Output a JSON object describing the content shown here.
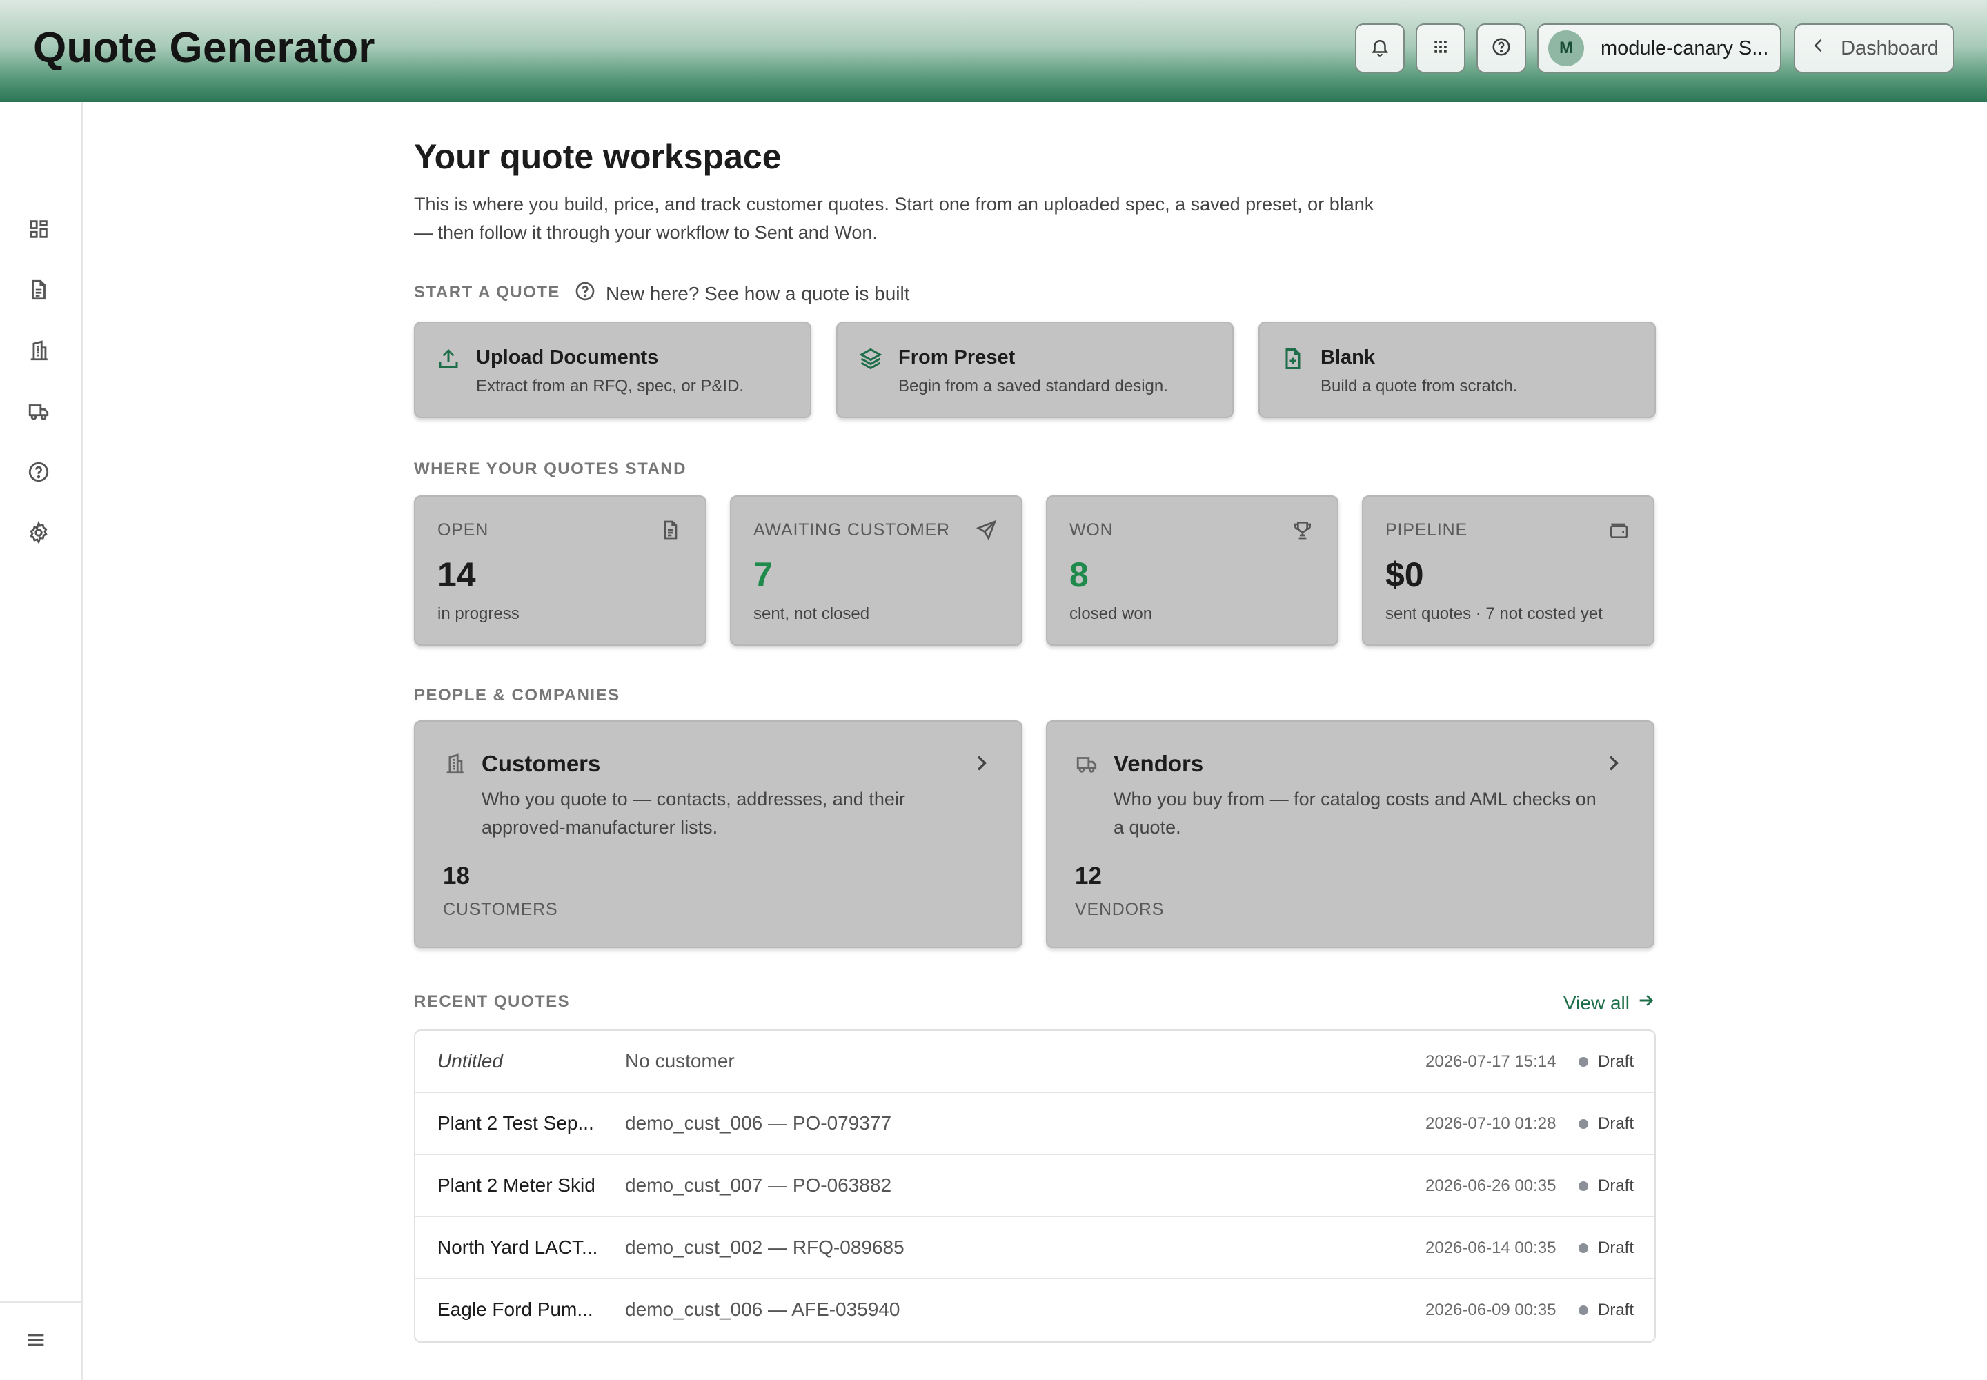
{
  "header": {
    "app_title": "Quote Generator",
    "user_initial": "M",
    "user_name": "module-canary S...",
    "dashboard_label": "Dashboard"
  },
  "sidebar": {
    "items": [
      {
        "icon": "dashboard-icon"
      },
      {
        "icon": "document-icon"
      },
      {
        "icon": "building-icon"
      },
      {
        "icon": "truck-icon"
      },
      {
        "icon": "help-icon"
      },
      {
        "icon": "settings-icon"
      }
    ],
    "footer_icon": "menu-icon"
  },
  "main": {
    "title": "Your quote workspace",
    "description": "This is where you build, price, and track customer quotes. Start one from an uploaded spec, a saved preset, or blank — then follow it through your workflow to Sent and Won.",
    "start_section": {
      "label": "START A QUOTE",
      "help_link": "New here? See how a quote is built",
      "cards": [
        {
          "icon": "upload-icon",
          "title": "Upload Documents",
          "subtitle": "Extract from an RFQ, spec, or P&ID."
        },
        {
          "icon": "layers-icon",
          "title": "From Preset",
          "subtitle": "Begin from a saved standard design."
        },
        {
          "icon": "file-plus-icon",
          "title": "Blank",
          "subtitle": "Build a quote from scratch."
        }
      ]
    },
    "stats_section": {
      "label": "WHERE YOUR QUOTES STAND",
      "cards": [
        {
          "label": "OPEN",
          "icon": "document-icon",
          "value": "14",
          "sub": "in progress"
        },
        {
          "label": "AWAITING CUSTOMER",
          "icon": "send-icon",
          "value": "7",
          "sub": "sent, not closed"
        },
        {
          "label": "WON",
          "icon": "trophy-icon",
          "value": "8",
          "sub": "closed won",
          "accent": "#1e8a4c"
        },
        {
          "label": "PIPELINE",
          "icon": "wallet-icon",
          "value": "$0",
          "sub": "sent quotes · 7 not costed yet"
        }
      ]
    },
    "people_section": {
      "label": "PEOPLE & COMPANIES",
      "cards": [
        {
          "icon": "building-icon",
          "title": "Customers",
          "description": "Who you quote to — contacts, addresses, and their approved-manufacturer lists.",
          "count": "18",
          "count_label": "CUSTOMERS"
        },
        {
          "icon": "truck-icon",
          "title": "Vendors",
          "description": "Who you buy from — for catalog costs and AML checks on a quote.",
          "count": "12",
          "count_label": "VENDORS"
        }
      ]
    },
    "recent_section": {
      "label": "RECENT QUOTES",
      "view_all": "View all",
      "rows": [
        {
          "name": "Untitled",
          "customer": "No customer",
          "date": "2026-07-17 15:14",
          "status": "Draft"
        },
        {
          "name": "Plant 2 Test Sep...",
          "customer": "demo_cust_006 — PO-079377",
          "date": "2026-07-10 01:28",
          "status": "Draft"
        },
        {
          "name": "Plant 2 Meter Skid",
          "customer": "demo_cust_007 — PO-063882",
          "date": "2026-06-26 00:35",
          "status": "Draft"
        },
        {
          "name": "North Yard LACT...",
          "customer": "demo_cust_002 — RFQ-089685",
          "date": "2026-06-14 00:35",
          "status": "Draft"
        },
        {
          "name": "Eagle Ford Pum...",
          "customer": "demo_cust_006 — AFE-035940",
          "date": "2026-06-09 00:35",
          "status": "Draft"
        }
      ]
    }
  },
  "colors": {
    "brand_green": "#1f6e4a",
    "won_green": "#1e8a4c",
    "draft_dot": "#8a8f98"
  }
}
